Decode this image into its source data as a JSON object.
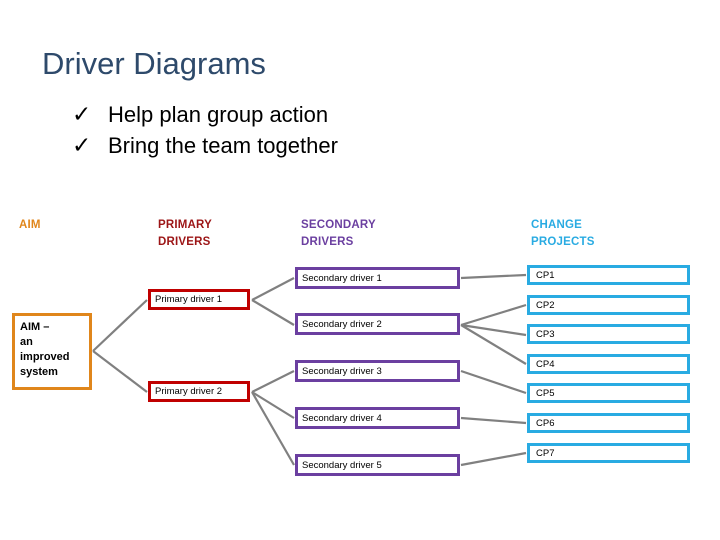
{
  "slide": {
    "title": "Driver Diagrams",
    "bullets": [
      {
        "marker": "✓",
        "text": "Help plan group action"
      },
      {
        "marker": "✓",
        "text": "Bring the team together"
      }
    ]
  },
  "columns": {
    "aim": {
      "label": "AIM",
      "color": "#e0861b"
    },
    "primary": {
      "label": "PRIMARY\nDRIVERS",
      "line1": "PRIMARY",
      "line2": "DRIVERS",
      "color": "#9c1516"
    },
    "secondary": {
      "label": "SECONDARY\nDRIVERS",
      "line1": "SECONDARY",
      "line2": "DRIVERS",
      "color": "#6b3fa0"
    },
    "change": {
      "label": "CHANGE\nPROJECTS",
      "line1": "CHANGE",
      "line2": "PROJECTS",
      "color": "#29abe2"
    }
  },
  "diagram": {
    "aim_node": {
      "text": "AIM – an improved system",
      "line1": "AIM –",
      "line2": "an",
      "line3": "improved",
      "line4": "system"
    },
    "primary_drivers": [
      {
        "id": "pd1",
        "label": "Primary driver 1"
      },
      {
        "id": "pd2",
        "label": "Primary driver 2"
      }
    ],
    "secondary_drivers": [
      {
        "id": "sd1",
        "label": "Secondary driver 1"
      },
      {
        "id": "sd2",
        "label": "Secondary driver 2"
      },
      {
        "id": "sd3",
        "label": "Secondary driver 3"
      },
      {
        "id": "sd4",
        "label": "Secondary driver 4"
      },
      {
        "id": "sd5",
        "label": "Secondary driver 5"
      }
    ],
    "change_projects": [
      {
        "id": "cp1",
        "label": "CP1"
      },
      {
        "id": "cp2",
        "label": "CP2"
      },
      {
        "id": "cp3",
        "label": "CP3"
      },
      {
        "id": "cp4",
        "label": "CP4"
      },
      {
        "id": "cp5",
        "label": "CP5"
      },
      {
        "id": "cp6",
        "label": "CP6"
      },
      {
        "id": "cp7",
        "label": "CP7"
      }
    ],
    "connector_color": "#808080",
    "links": [
      {
        "from": "aim_node",
        "to": "pd1"
      },
      {
        "from": "aim_node",
        "to": "pd2"
      },
      {
        "from": "pd1",
        "to": "sd1"
      },
      {
        "from": "pd1",
        "to": "sd2"
      },
      {
        "from": "pd2",
        "to": "sd3"
      },
      {
        "from": "pd2",
        "to": "sd4"
      },
      {
        "from": "pd2",
        "to": "sd5"
      },
      {
        "from": "sd1",
        "to": "cp1"
      },
      {
        "from": "sd2",
        "to": "cp2"
      },
      {
        "from": "sd2",
        "to": "cp3"
      },
      {
        "from": "sd2",
        "to": "cp4"
      },
      {
        "from": "sd3",
        "to": "cp5"
      },
      {
        "from": "sd4",
        "to": "cp6"
      },
      {
        "from": "sd5",
        "to": "cp7"
      }
    ]
  },
  "theme": {
    "title_color": "#2e4a6b",
    "aim_border": "#e0861b",
    "primary_border": "#c00000",
    "secondary_border": "#6b3fa0",
    "change_border": "#29abe2",
    "background": "#ffffff"
  }
}
